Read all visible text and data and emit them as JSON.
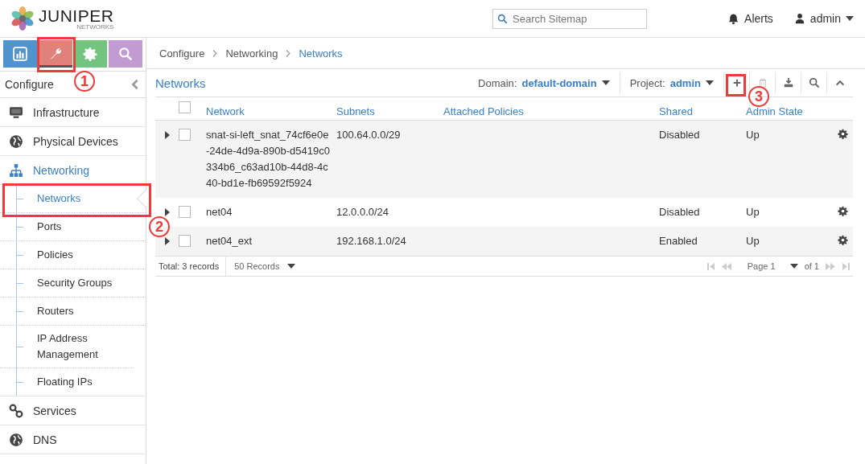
{
  "header": {
    "logo": {
      "wordmark": "JUNIPER",
      "tagline": "NETWORKS"
    },
    "search": {
      "placeholder": "Search Sitemap"
    },
    "alerts": "Alerts",
    "user": "admin"
  },
  "nav_tabs": [
    {
      "kind": "monitor",
      "selected": false,
      "color": "#4f94cd"
    },
    {
      "kind": "configure",
      "selected": true,
      "color": "#e0827a"
    },
    {
      "kind": "settings",
      "selected": false,
      "color": "#73c47e"
    },
    {
      "kind": "query",
      "selected": false,
      "color": "#c39bd3"
    }
  ],
  "sidebar": {
    "title": "Configure",
    "items": [
      {
        "label": "Infrastructure",
        "kind": "monitor",
        "selected": false
      },
      {
        "label": "Physical Devices",
        "kind": "globe",
        "selected": false
      },
      {
        "label": "Networking",
        "kind": "sitemap",
        "selected": true,
        "children": [
          {
            "label": "Networks",
            "selected": true
          },
          {
            "label": "Ports",
            "selected": false
          },
          {
            "label": "Policies",
            "selected": false
          },
          {
            "label": "Security Groups",
            "selected": false
          },
          {
            "label": "Routers",
            "selected": false
          },
          {
            "label": "IP Address Management",
            "selected": false
          },
          {
            "label": "Floating IPs",
            "selected": false
          }
        ]
      },
      {
        "label": "Services",
        "kind": "link",
        "selected": false
      },
      {
        "label": "DNS",
        "kind": "globe",
        "selected": false
      }
    ]
  },
  "breadcrumb": [
    "Configure",
    "Networking",
    "Networks"
  ],
  "panel": {
    "title": "Networks",
    "domain": {
      "label": "Domain:",
      "value": "default-domain"
    },
    "project": {
      "label": "Project:",
      "value": "admin"
    },
    "toolbar": [
      {
        "kind": "add",
        "disabled": false
      },
      {
        "kind": "delete",
        "disabled": true
      },
      {
        "kind": "export",
        "disabled": false
      },
      {
        "kind": "search",
        "disabled": false
      },
      {
        "kind": "collapse",
        "disabled": false
      }
    ]
  },
  "table": {
    "columns": [
      "Network",
      "Subnets",
      "Attached Policies",
      "Shared",
      "Admin State"
    ],
    "header_checked": false,
    "rows": [
      {
        "network": "snat-si-left_snat_74cf6e0e-24de-4d9a-890b-d5419c0334b6_c63ad10b-44d8-4c40-bd1e-fb69592f5924",
        "subnets": "100.64.0.0/29",
        "shared": "Disabled",
        "admin_state": "Up",
        "checked": false
      },
      {
        "network": "net04",
        "subnets": "12.0.0.0/24",
        "shared": "Disabled",
        "admin_state": "Up",
        "checked": false
      },
      {
        "network": "net04_ext",
        "subnets": "192.168.1.0/24",
        "shared": "Enabled",
        "admin_state": "Up",
        "checked": false
      }
    ]
  },
  "footer": {
    "total": "Total: 3 records",
    "page_size": "50 Records",
    "page": "Page 1",
    "of": "of 1"
  },
  "annotations": [
    {
      "label": "1"
    },
    {
      "label": "2"
    },
    {
      "label": "3"
    }
  ]
}
